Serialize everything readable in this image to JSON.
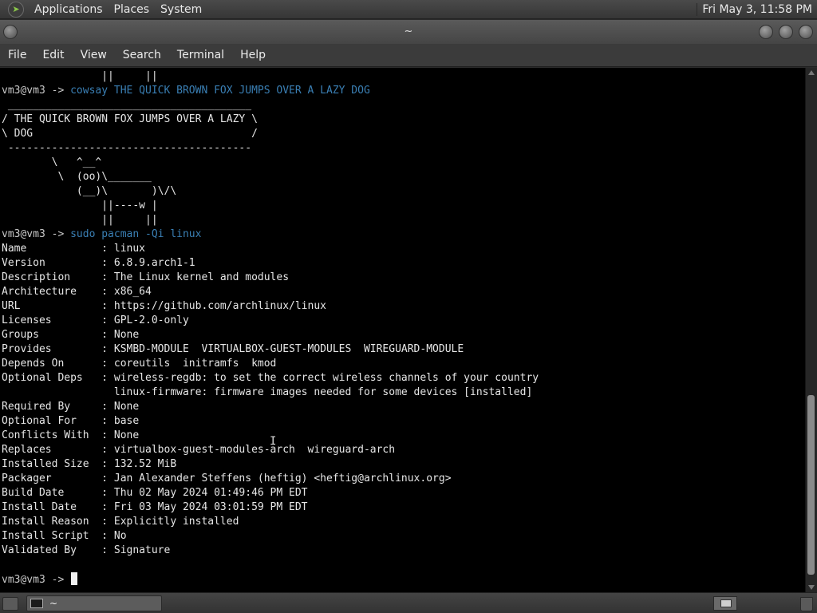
{
  "top_panel": {
    "menus": [
      "Applications",
      "Places",
      "System"
    ],
    "clock": "Fri May  3, 11:58 PM"
  },
  "window": {
    "title": "~",
    "menus": [
      "File",
      "Edit",
      "View",
      "Search",
      "Terminal",
      "Help"
    ]
  },
  "terminal": {
    "lines": [
      {
        "text": "                ||     ||"
      },
      {
        "prompt": "vm3@vm3 -> ",
        "cmd": "cowsay THE QUICK BROWN FOX JUMPS OVER A LAZY DOG"
      },
      {
        "text": " _______________________________________"
      },
      {
        "text": "/ THE QUICK BROWN FOX JUMPS OVER A LAZY \\"
      },
      {
        "text": "\\ DOG                                   /"
      },
      {
        "text": " ---------------------------------------"
      },
      {
        "text": "        \\   ^__^"
      },
      {
        "text": "         \\  (oo)\\_______"
      },
      {
        "text": "            (__)\\       )\\/\\"
      },
      {
        "text": "                ||----w |"
      },
      {
        "text": "                ||     ||"
      },
      {
        "prompt": "vm3@vm3 -> ",
        "cmd": "sudo pacman -Qi linux"
      },
      {
        "text": "Name            : linux"
      },
      {
        "text": "Version         : 6.8.9.arch1-1"
      },
      {
        "text": "Description     : The Linux kernel and modules"
      },
      {
        "text": "Architecture    : x86_64"
      },
      {
        "text": "URL             : https://github.com/archlinux/linux"
      },
      {
        "text": "Licenses        : GPL-2.0-only"
      },
      {
        "text": "Groups          : None"
      },
      {
        "text": "Provides        : KSMBD-MODULE  VIRTUALBOX-GUEST-MODULES  WIREGUARD-MODULE"
      },
      {
        "text": "Depends On      : coreutils  initramfs  kmod"
      },
      {
        "text": "Optional Deps   : wireless-regdb: to set the correct wireless channels of your country"
      },
      {
        "text": "                  linux-firmware: firmware images needed for some devices [installed]"
      },
      {
        "text": "Required By     : None"
      },
      {
        "text": "Optional For    : base"
      },
      {
        "text": "Conflicts With  : None"
      },
      {
        "text": "Replaces        : virtualbox-guest-modules-arch  wireguard-arch"
      },
      {
        "text": "Installed Size  : 132.52 MiB"
      },
      {
        "text": "Packager        : Jan Alexander Steffens (heftig) <heftig@archlinux.org>"
      },
      {
        "text": "Build Date      : Thu 02 May 2024 01:49:46 PM EDT"
      },
      {
        "text": "Install Date    : Fri 03 May 2024 03:01:59 PM EDT"
      },
      {
        "text": "Install Reason  : Explicitly installed"
      },
      {
        "text": "Install Script  : No"
      },
      {
        "text": "Validated By    : Signature"
      },
      {
        "text": ""
      },
      {
        "prompt": "vm3@vm3 -> ",
        "cmd": "",
        "cursor": true
      }
    ]
  },
  "taskbar": {
    "task_label": "~"
  },
  "colors": {
    "command": "#3a7fb4",
    "terminal_bg": "#000000",
    "terminal_fg": "#e6e6e6"
  }
}
